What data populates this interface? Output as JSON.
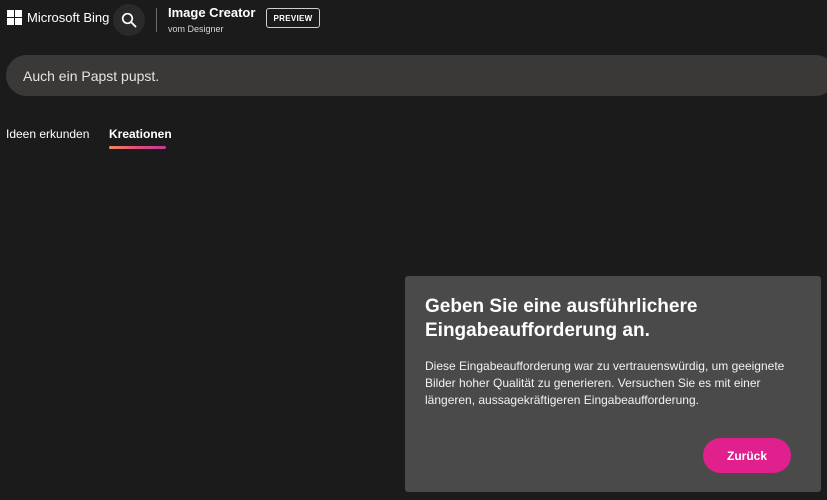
{
  "header": {
    "brand": "Microsoft Bing",
    "app_title": "Image Creator",
    "app_subtitle": "vom Designer",
    "badge": "PREVIEW"
  },
  "prompt": {
    "value": "Auch ein Papst pupst."
  },
  "tabs": [
    {
      "label": "Ideen erkunden",
      "active": false
    },
    {
      "label": "Kreationen",
      "active": true
    }
  ],
  "dialog": {
    "title": "Geben Sie eine ausführlichere Eingabeaufforderung an.",
    "body": "Diese Eingabeaufforderung war zu vertrauenswürdig, um geeignete Bilder hoher Qualität zu generieren. Versuchen Sie es mit einer längeren, aussagekräftigeren Eingabeaufforderung.",
    "button": "Zurück"
  },
  "colors": {
    "background": "#1c1b1b",
    "prompt_bar": "#3a3938",
    "dialog": "#4a4a4a",
    "accent": "#e0208d"
  },
  "icons": {
    "logo": "microsoft-logo-icon",
    "search": "search-icon"
  }
}
